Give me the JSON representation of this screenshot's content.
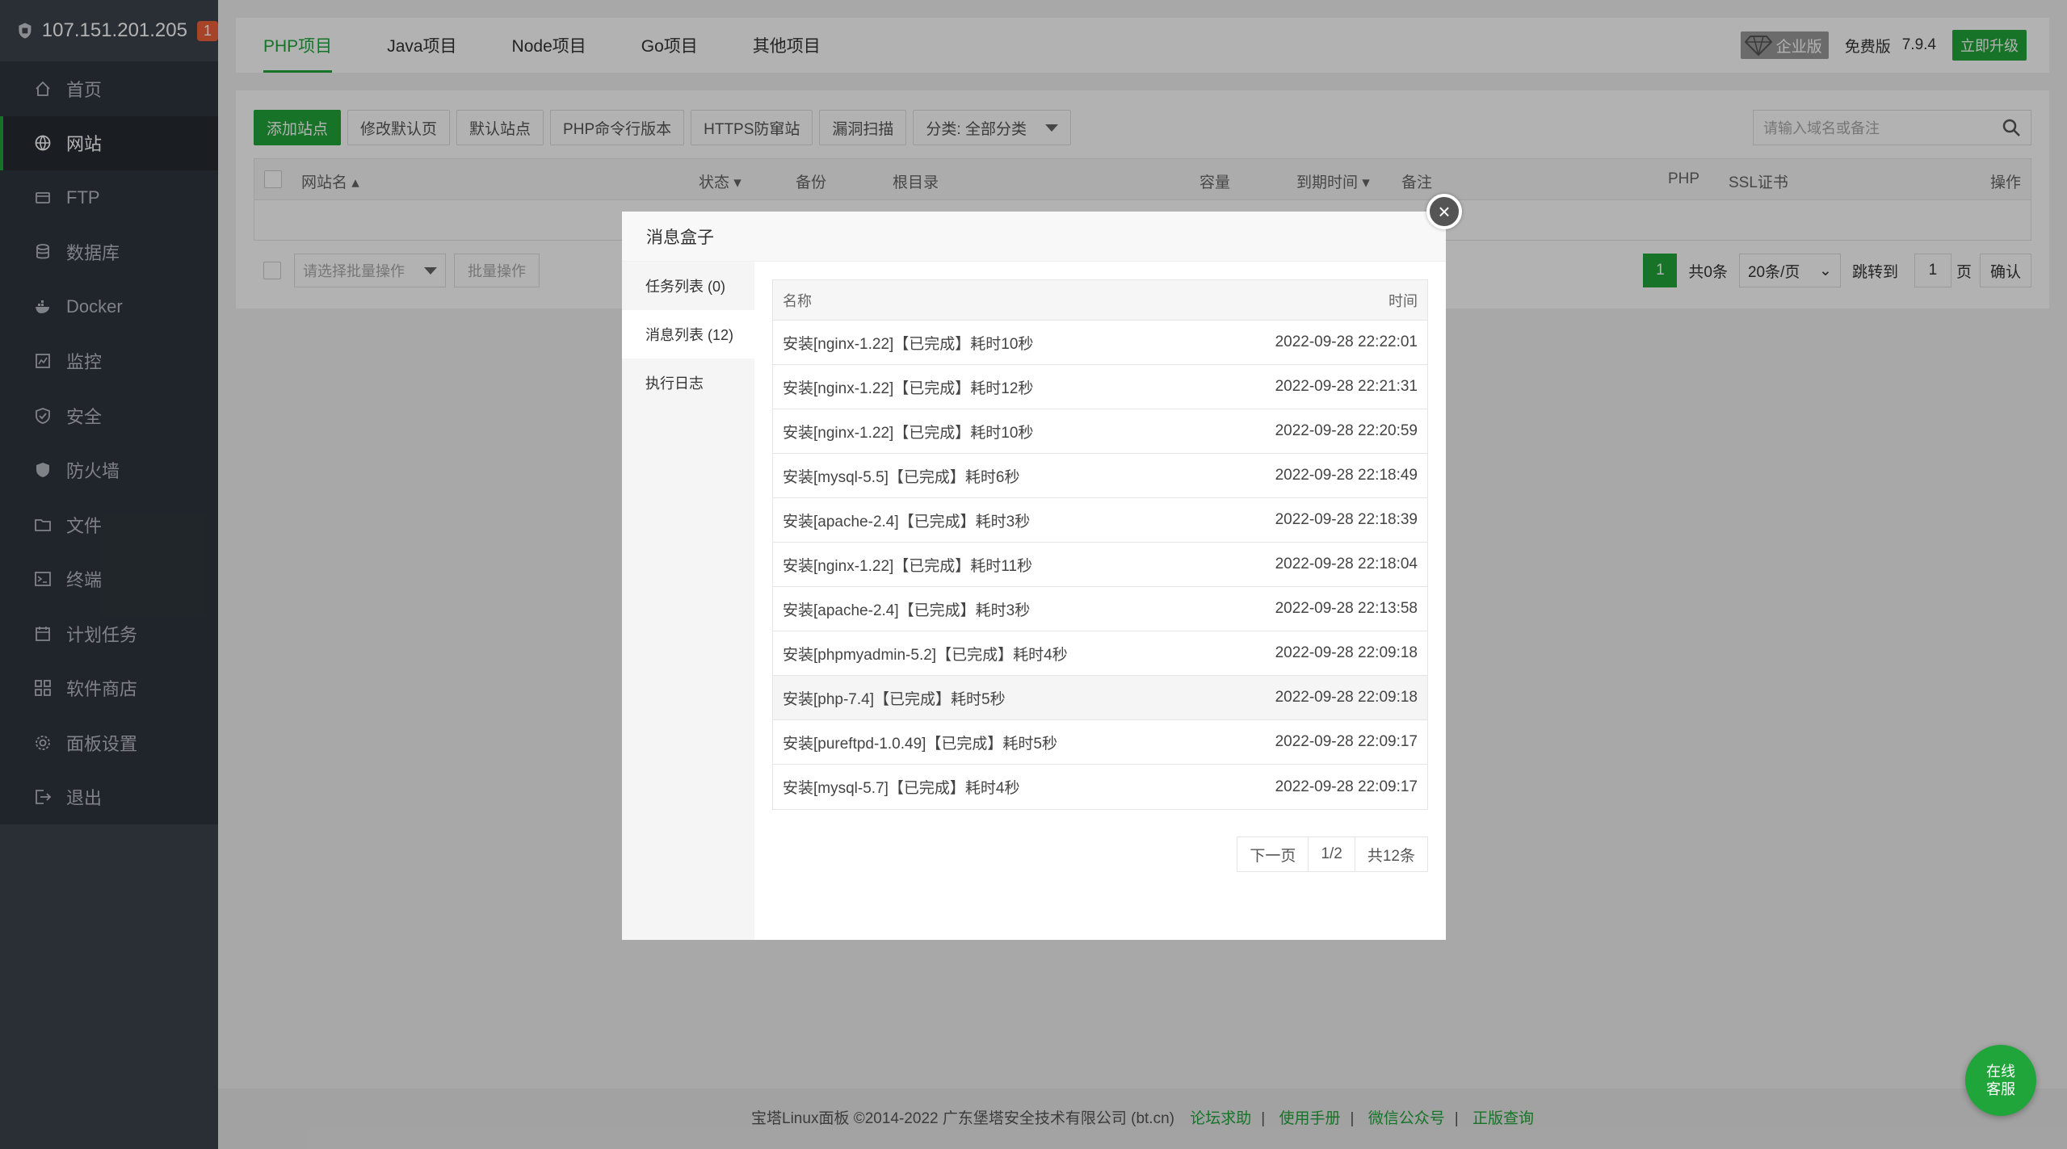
{
  "header": {
    "ip": "107.151.201.205",
    "badge": "1"
  },
  "sidebar": {
    "items": [
      {
        "label": "首页",
        "icon": "home-icon"
      },
      {
        "label": "网站",
        "icon": "globe-icon",
        "active": true
      },
      {
        "label": "FTP",
        "icon": "ftp-icon"
      },
      {
        "label": "数据库",
        "icon": "database-icon"
      },
      {
        "label": "Docker",
        "icon": "docker-icon"
      },
      {
        "label": "监控",
        "icon": "monitor-icon"
      },
      {
        "label": "安全",
        "icon": "security-icon"
      },
      {
        "label": "防火墙",
        "icon": "firewall-icon"
      },
      {
        "label": "文件",
        "icon": "folder-icon"
      },
      {
        "label": "终端",
        "icon": "terminal-icon"
      },
      {
        "label": "计划任务",
        "icon": "calendar-icon"
      },
      {
        "label": "软件商店",
        "icon": "apps-icon"
      },
      {
        "label": "面板设置",
        "icon": "settings-icon"
      },
      {
        "label": "退出",
        "icon": "logout-icon"
      }
    ]
  },
  "tabs": [
    "PHP项目",
    "Java项目",
    "Node项目",
    "Go项目",
    "其他项目"
  ],
  "topright": {
    "enterprise": "企业版",
    "free": "免费版",
    "version": "7.9.4",
    "upgrade": "立即升级"
  },
  "toolbar": {
    "add": "添加站点",
    "default_page": "修改默认页",
    "default_site": "默认站点",
    "php_cli": "PHP命令行版本",
    "https": "HTTPS防窜站",
    "scan": "漏洞扫描",
    "category": "分类: 全部分类",
    "search_placeholder": "请输入域名或备注"
  },
  "table": {
    "headers": {
      "name": "网站名",
      "status": "状态",
      "backup": "备份",
      "root": "根目录",
      "capacity": "容量",
      "expire": "到期时间",
      "remark": "备注",
      "php": "PHP",
      "ssl": "SSL证书",
      "action": "操作"
    }
  },
  "batch": {
    "select": "请选择批量操作",
    "button": "批量操作"
  },
  "pager": {
    "page": "1",
    "total": "共0条",
    "per_page": "20条/页",
    "jump": "跳转到",
    "jump_value": "1",
    "page_unit": "页",
    "confirm": "确认"
  },
  "footer": {
    "copyright": "宝塔Linux面板 ©2014-2022 广东堡塔安全技术有限公司 (bt.cn)",
    "links": [
      "论坛求助",
      "使用手册",
      "微信公众号",
      "正版查询"
    ]
  },
  "modal": {
    "title": "消息盒子",
    "close": "×",
    "side": [
      "任务列表 (0)",
      "消息列表 (12)",
      "执行日志"
    ],
    "columns": {
      "name": "名称",
      "time": "时间"
    },
    "rows": [
      {
        "name": "安装[nginx-1.22]【已完成】耗时10秒",
        "time": "2022-09-28 22:22:01"
      },
      {
        "name": "安装[nginx-1.22]【已完成】耗时12秒",
        "time": "2022-09-28 22:21:31"
      },
      {
        "name": "安装[nginx-1.22]【已完成】耗时10秒",
        "time": "2022-09-28 22:20:59"
      },
      {
        "name": "安装[mysql-5.5]【已完成】耗时6秒",
        "time": "2022-09-28 22:18:49"
      },
      {
        "name": "安装[apache-2.4]【已完成】耗时3秒",
        "time": "2022-09-28 22:18:39"
      },
      {
        "name": "安装[nginx-1.22]【已完成】耗时11秒",
        "time": "2022-09-28 22:18:04"
      },
      {
        "name": "安装[apache-2.4]【已完成】耗时3秒",
        "time": "2022-09-28 22:13:58"
      },
      {
        "name": "安装[phpmyadmin-5.2]【已完成】耗时4秒",
        "time": "2022-09-28 22:09:18"
      },
      {
        "name": "安装[php-7.4]【已完成】耗时5秒",
        "time": "2022-09-28 22:09:18"
      },
      {
        "name": "安装[pureftpd-1.0.49]【已完成】耗时5秒",
        "time": "2022-09-28 22:09:17"
      },
      {
        "name": "安装[mysql-5.7]【已完成】耗时4秒",
        "time": "2022-09-28 22:09:17"
      }
    ],
    "pager": {
      "next": "下一页",
      "page": "1/2",
      "total": "共12条"
    }
  },
  "chat": {
    "line1": "在线",
    "line2": "客服"
  },
  "colors": {
    "accent": "#20a53a",
    "sidebar": "#2f363e",
    "badge": "#f0623a"
  }
}
